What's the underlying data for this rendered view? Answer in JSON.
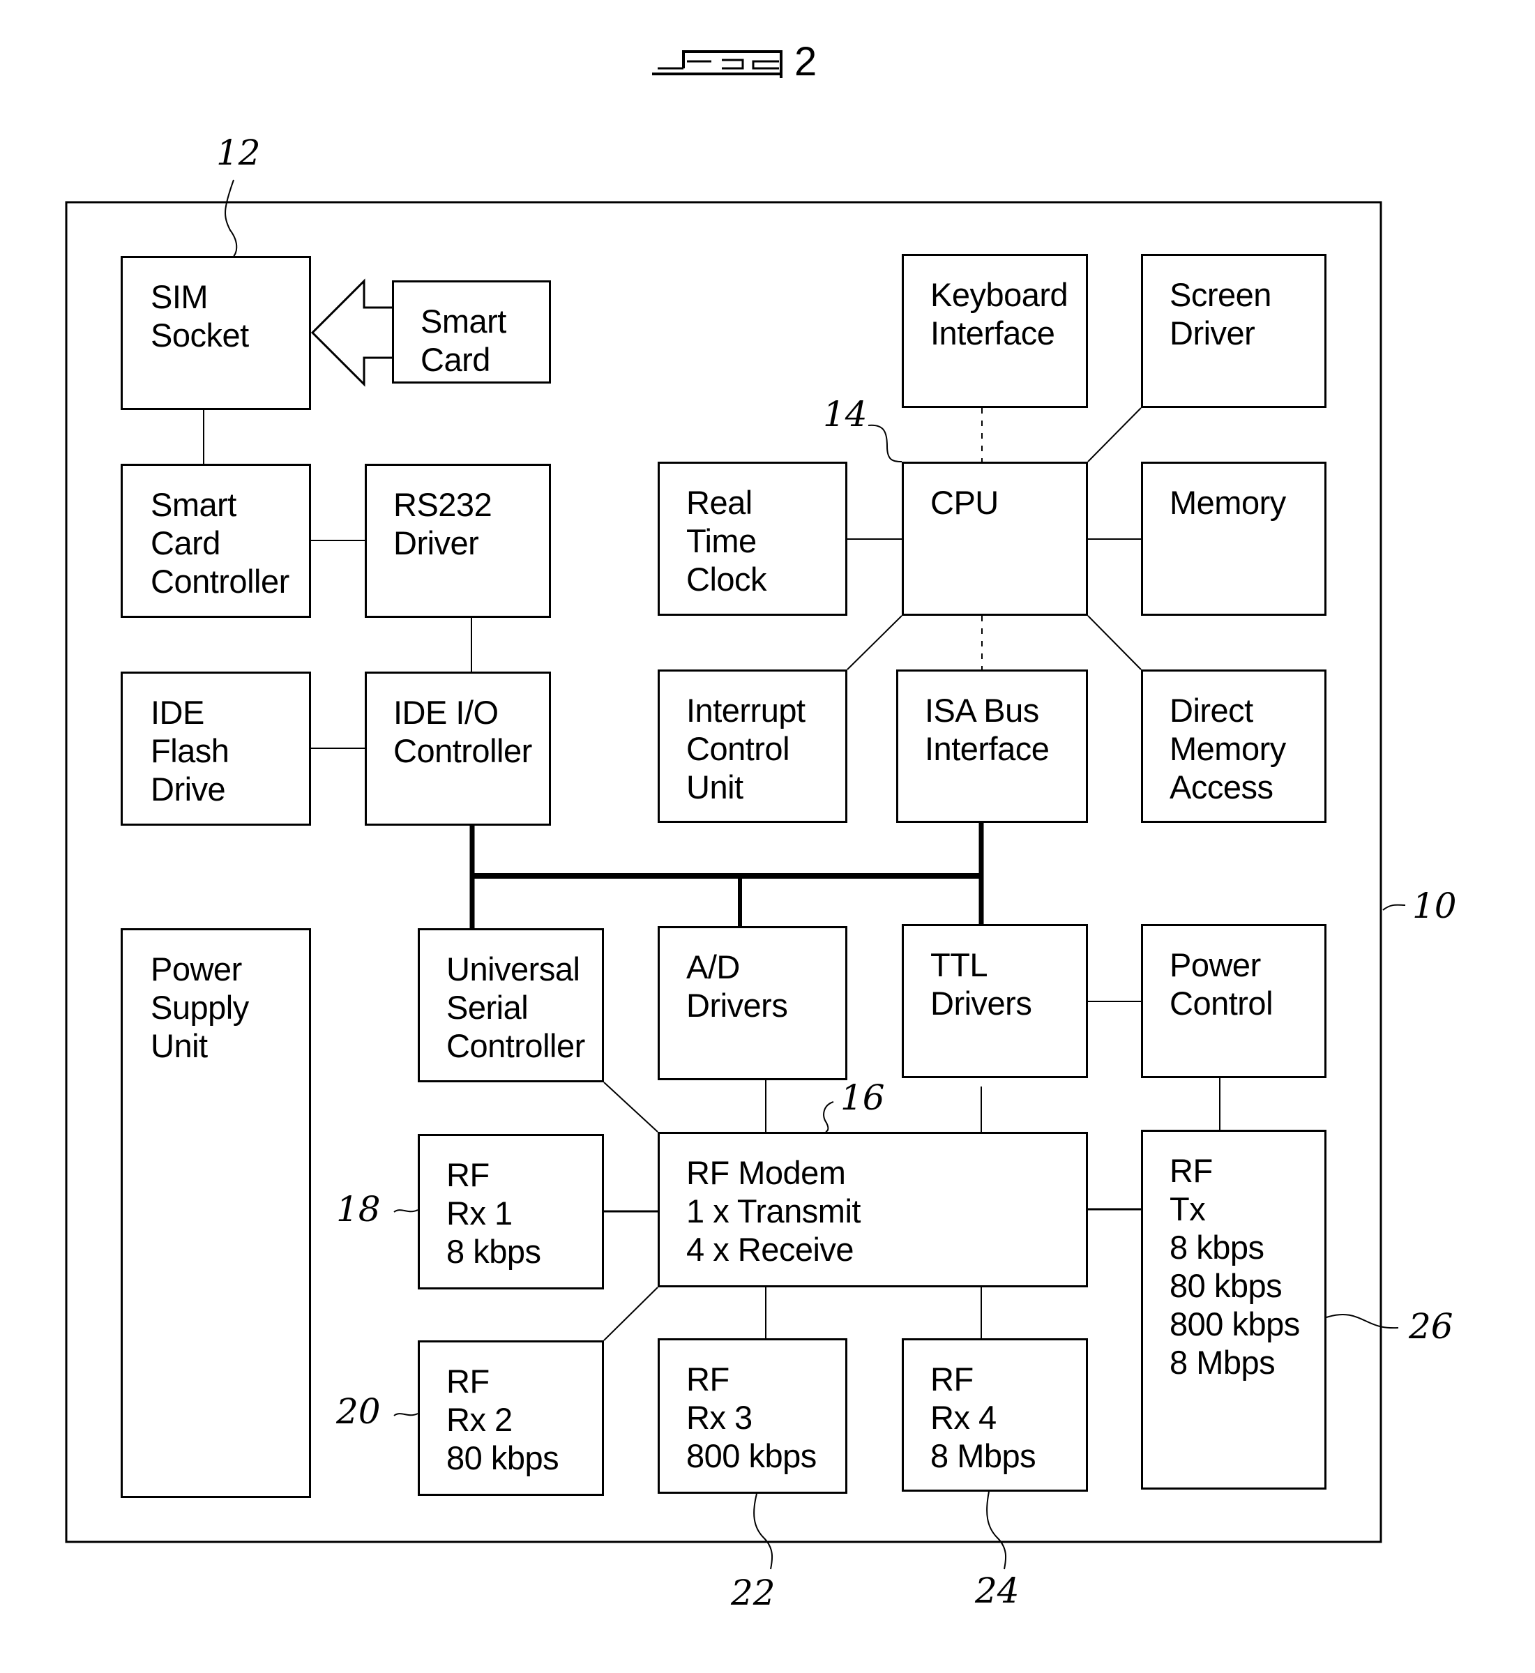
{
  "figure": {
    "label": "2",
    "glyph": "fig-symbol"
  },
  "reference_numerals": {
    "device": "10",
    "sim_socket": "12",
    "cpu": "14",
    "rf_modem": "16",
    "rf_rx1": "18",
    "rf_rx2": "20",
    "rf_rx3": "22",
    "rf_rx4": "24",
    "rf_tx": "26"
  },
  "blocks": {
    "sim_socket": "SIM\nSocket",
    "smart_card": "Smart\nCard",
    "keyboard_interface": "Keyboard\nInterface",
    "screen_driver": "Screen\nDriver",
    "smart_card_controller": "Smart\nCard\nController",
    "rs232_driver": "RS232\nDriver",
    "real_time_clock": "Real\nTime\nClock",
    "cpu": "CPU",
    "memory": "Memory",
    "ide_flash_drive": "IDE\nFlash\nDrive",
    "ide_io_controller": "IDE I/O\nController",
    "interrupt_control_unit": "Interrupt\nControl\nUnit",
    "isa_bus_interface": "ISA Bus\nInterface",
    "direct_memory_access": "Direct\nMemory\nAccess",
    "power_supply_unit": "Power\nSupply\nUnit",
    "universal_serial_controller": "Universal\nSerial\nController",
    "ad_drivers": "A/D\nDrivers",
    "ttl_drivers": "TTL\nDrivers",
    "power_control": "Power\nControl",
    "rf_rx1": "RF\nRx 1\n8 kbps",
    "rf_modem": "RF Modem\n1 x Transmit\n4 x Receive",
    "rf_tx": "RF\nTx\n8 kbps\n80 kbps\n800 kbps\n8 Mbps",
    "rf_rx2": "RF\nRx 2\n80 kbps",
    "rf_rx3": "RF\nRx 3\n800 kbps",
    "rf_rx4": "RF\nRx 4\n8 Mbps"
  }
}
